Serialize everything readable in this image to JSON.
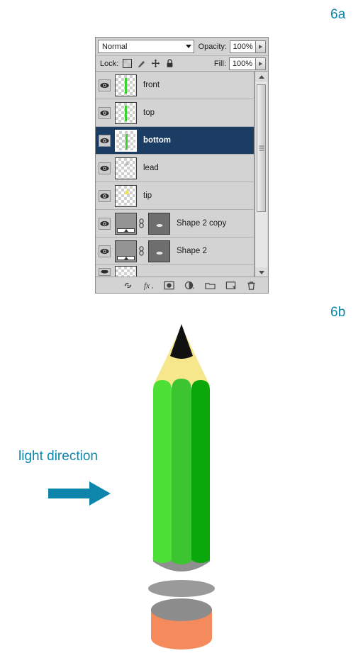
{
  "figures": {
    "panel_label": "6a",
    "illustration_label": "6b"
  },
  "layers_panel": {
    "blend_mode": {
      "value": "Normal",
      "icon": "chevron-down-icon"
    },
    "opacity": {
      "label": "Opacity:",
      "value": "100%",
      "stepper_icon": "chevron-right-icon"
    },
    "fill": {
      "label": "Fill:",
      "value": "100%",
      "stepper_icon": "chevron-right-icon"
    },
    "lock": {
      "label": "Lock:",
      "icons": [
        "lock-transparency-icon",
        "lock-image-pixels-icon",
        "lock-position-icon",
        "lock-all-icon"
      ]
    },
    "layers": [
      {
        "name": "front",
        "visible": true,
        "selected": false,
        "thumb": "transparent-green-stripe",
        "has_mask": false,
        "visibility_icon": "eye-icon"
      },
      {
        "name": "top",
        "visible": true,
        "selected": false,
        "thumb": "transparent-green-stripe",
        "has_mask": false,
        "visibility_icon": "eye-icon"
      },
      {
        "name": "bottom",
        "visible": true,
        "selected": true,
        "thumb": "transparent-green-stripe",
        "has_mask": false,
        "visibility_icon": "eye-icon"
      },
      {
        "name": "lead",
        "visible": true,
        "selected": false,
        "thumb": "transparent-gray-lead",
        "has_mask": false,
        "visibility_icon": "eye-icon"
      },
      {
        "name": "tip",
        "visible": true,
        "selected": false,
        "thumb": "transparent-yellow-tip",
        "has_mask": false,
        "visibility_icon": "eye-icon"
      },
      {
        "name": "Shape 2 copy",
        "visible": true,
        "selected": false,
        "thumb": "gray-shape",
        "has_mask": true,
        "link_icon": "link-chain-icon",
        "visibility_icon": "eye-icon"
      },
      {
        "name": "Shape 2",
        "visible": true,
        "selected": false,
        "thumb": "gray-shape",
        "has_mask": true,
        "link_icon": "link-chain-icon",
        "visibility_icon": "eye-icon"
      }
    ],
    "scrollbar": {
      "up_icon": "triangle-up-icon",
      "down_icon": "triangle-down-icon",
      "thumb_icon": "scrollbar-grip-icon"
    },
    "toolbar_buttons": [
      "link-layers-icon",
      "layer-style-fx-icon",
      "add-layer-mask-icon",
      "adjustment-layer-icon",
      "new-group-icon",
      "new-layer-icon",
      "delete-layer-icon"
    ]
  },
  "illustration": {
    "light_direction_label": "light direction",
    "arrow_icon": "arrow-right-icon",
    "colors": {
      "accent_teal": "#0e86ab",
      "lead_black": "#111111",
      "wood_yellow": "#f6e78c",
      "barrel_light_green": "#4ce036",
      "barrel_mid_green": "#3cc431",
      "barrel_dark_green": "#0aa80a",
      "shadow_gray": "#9a9a9a",
      "cylinder_top_gray": "#8c8c8c",
      "cylinder_body_orange": "#f58b5c"
    }
  }
}
